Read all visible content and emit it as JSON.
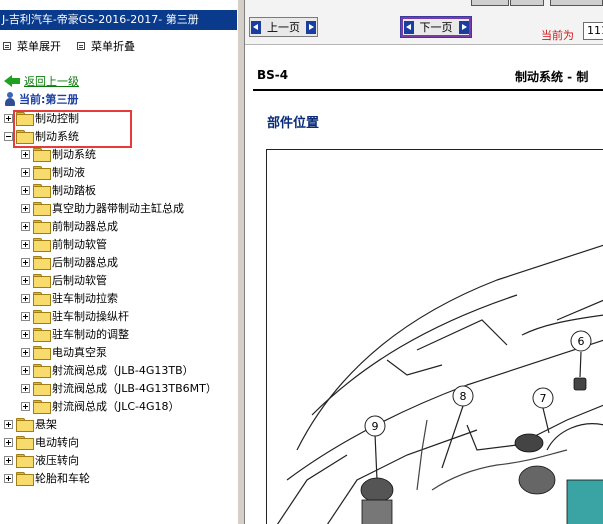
{
  "left_pane": {
    "book_title": "J-吉利汽车-帝豪GS-2016-2017- 第三册",
    "expand_all_label": "菜单展开",
    "collapse_all_label": "菜单折叠",
    "back_link": "返回上一级",
    "current_label": "当前:第三册",
    "tree": {
      "top_items": [
        "制动控制",
        "制动系统"
      ],
      "children": [
        "制动系统",
        "制动液",
        "制动踏板",
        "真空助力器带制动主缸总成",
        "前制动器总成",
        "前制动软管",
        "后制动器总成",
        "后制动软管",
        "驻车制动拉索",
        "驻车制动操纵杆",
        "驻车制动的调整",
        "电动真空泵",
        "射流阀总成（JLB-4G13TB）",
        "射流阀总成（JLB-4G13TB6MT）",
        "射流阀总成（JLC-4G18）"
      ],
      "bottom_items": [
        "悬架",
        "电动转向",
        "液压转向",
        "轮胎和车轮"
      ]
    }
  },
  "toolbar": {
    "prev_label": "上一页",
    "next_label": "下一页",
    "current_page_label": "当前为",
    "current_page_value": "111"
  },
  "document": {
    "code": "BS-4",
    "section": "制动系统 - 制",
    "heading": "部件位置",
    "callouts": [
      "6",
      "7",
      "8",
      "9"
    ]
  },
  "colors": {
    "title_bar": "#0a3a8c",
    "highlight": "#e43b3b",
    "link_green": "#0a7a0a",
    "current_blue": "#1a3ea0",
    "page_label_red": "#d11a1a"
  }
}
